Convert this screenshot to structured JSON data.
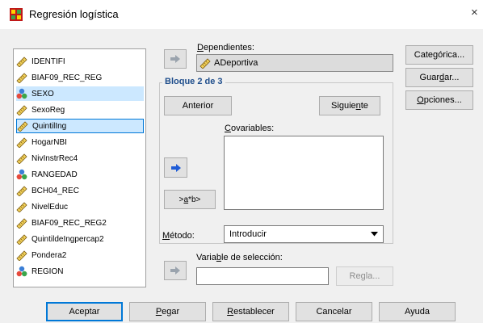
{
  "window": {
    "title": "Regresión logística",
    "close_glyph": "×"
  },
  "variables": [
    {
      "name": "IDENTIFI",
      "icon": "ruler-icon"
    },
    {
      "name": "BIAF09_REC_REG",
      "icon": "ruler-icon"
    },
    {
      "name": "SEXO",
      "icon": "nominal-icon"
    },
    {
      "name": "SexoReg",
      "icon": "ruler-icon"
    },
    {
      "name": "QuintilIng",
      "icon": "ruler-icon"
    },
    {
      "name": "HogarNBI",
      "icon": "ruler-icon"
    },
    {
      "name": "NivInstrRec4",
      "icon": "ruler-icon"
    },
    {
      "name": "RANGEDAD",
      "icon": "nominal-icon"
    },
    {
      "name": "BCH04_REC",
      "icon": "ruler-icon"
    },
    {
      "name": "NivelEduc",
      "icon": "ruler-icon"
    },
    {
      "name": "BIAF09_REC_REG2",
      "icon": "ruler-icon"
    },
    {
      "name": "QuintildeIngpercap2",
      "icon": "ruler-icon"
    },
    {
      "name": "Pondera2",
      "icon": "ruler-icon"
    },
    {
      "name": "REGION",
      "icon": "nominal-icon"
    }
  ],
  "dependent": {
    "label_pre": "",
    "label_u": "D",
    "label_post": "ependientes:",
    "value": "ADeportiva"
  },
  "block": {
    "label": "Bloque 2 de 3",
    "prev_label": "Anterior",
    "next_pre": "Siguie",
    "next_u": "n",
    "next_post": "te"
  },
  "covariates": {
    "label_pre": "",
    "label_u": "C",
    "label_post": "ovariables:",
    "interaction_pre": ">",
    "interaction_u": "a",
    "interaction_post": "*b>"
  },
  "method": {
    "label_pre": "",
    "label_u": "M",
    "label_post": "étodo:",
    "value": "Introducir"
  },
  "selection": {
    "label_pre": "Varia",
    "label_u": "b",
    "label_post": "le de selección:",
    "rule_label": "Regla..."
  },
  "side_buttons": {
    "categorical": {
      "pre": "Cate",
      "u": "g",
      "post": "órica..."
    },
    "save": {
      "pre": "Guar",
      "u": "d",
      "post": "ar..."
    },
    "options": {
      "pre": "",
      "u": "O",
      "post": "pciones..."
    }
  },
  "bottom_buttons": {
    "accept": "Aceptar",
    "paste": {
      "pre": "",
      "u": "P",
      "post": "egar"
    },
    "reset": {
      "pre": "",
      "u": "R",
      "post": "establecer"
    },
    "cancel": "Cancelar",
    "help": "Ayuda"
  },
  "colors": {
    "selection": "#cce8ff",
    "focus": "#0078d7",
    "block_label": "#1f4e8c",
    "arrow_blue": "#1e5bd6"
  }
}
